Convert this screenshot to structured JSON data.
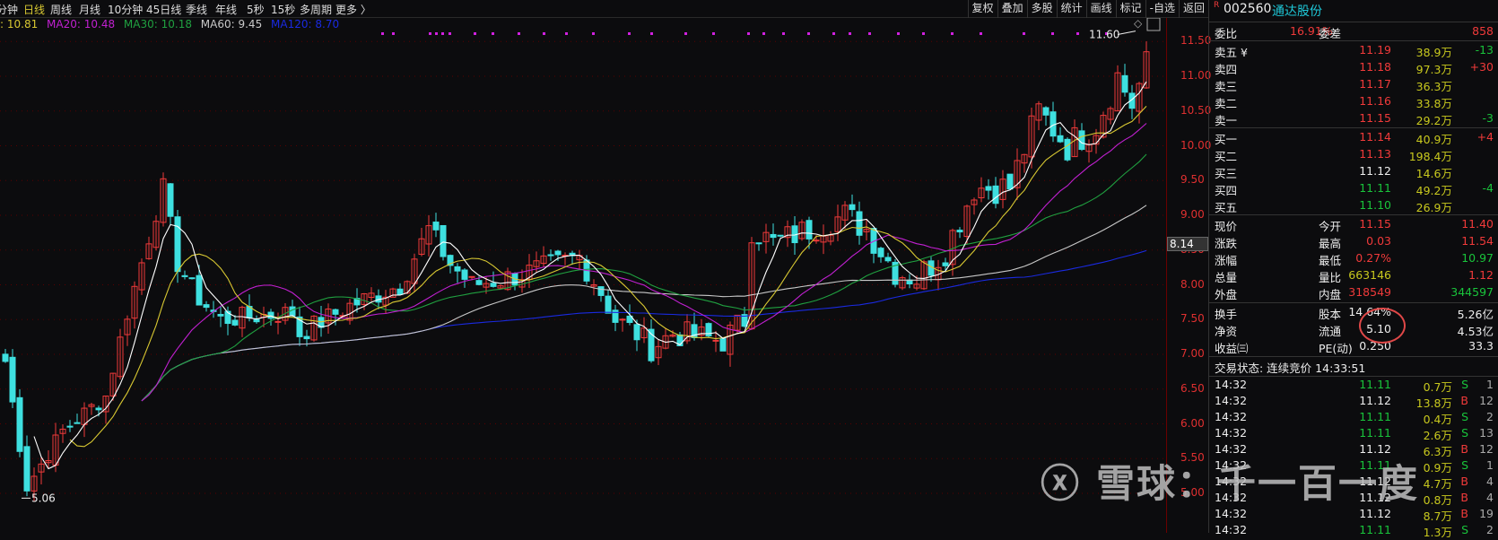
{
  "topbar": {
    "periods": [
      "分钟",
      "日线",
      "周线",
      "月线",
      "10分钟",
      "45日线",
      "季线",
      "年线",
      "5秒",
      "15秒",
      "多周期",
      "更多 〉"
    ],
    "active": "日线",
    "tools": [
      "复权",
      "叠加",
      "多股",
      "统计",
      "画线",
      "标记",
      "-自选",
      "返回"
    ]
  },
  "legend": {
    "ma10": ": 10.81",
    "ma20": "MA20: 10.48",
    "ma30": "MA30: 10.18",
    "ma60": "MA60: 9.45",
    "ma120": "MA120: 8.70"
  },
  "colors": {
    "up": "#f03a3a",
    "down": "#3ee0e0",
    "ma5": "#ffffff",
    "ma10": "#d8c832",
    "ma20": "#c020d0",
    "ma30": "#20a040",
    "ma60": "#c8c8c8",
    "ma120": "#1a2ae0"
  },
  "chart_data": {
    "type": "candlestick",
    "ylim": [
      5.0,
      11.75
    ],
    "yticks": [
      "11.50",
      "11.00",
      "10.50",
      "10.00",
      "9.50",
      "9.00",
      "8.50",
      "8.00",
      "7.50",
      "7.00",
      "6.50",
      "6.00",
      "5.50",
      "5.00"
    ],
    "price_path": [
      [
        0,
        6.9
      ],
      [
        3,
        5.1
      ],
      [
        8,
        5.9
      ],
      [
        14,
        6.4
      ],
      [
        17,
        7.6
      ],
      [
        22,
        9.4
      ],
      [
        24,
        8.3
      ],
      [
        27,
        7.8
      ],
      [
        30,
        7.5
      ],
      [
        40,
        7.6
      ],
      [
        41,
        7.3
      ],
      [
        48,
        7.7
      ],
      [
        55,
        8.0
      ],
      [
        59,
        8.8
      ],
      [
        62,
        8.3
      ],
      [
        65,
        8.0
      ],
      [
        70,
        8.1
      ],
      [
        77,
        8.3
      ],
      [
        80,
        8.4
      ],
      [
        83,
        7.9
      ],
      [
        85,
        7.5
      ],
      [
        88,
        7.3
      ],
      [
        90,
        7.1
      ],
      [
        93,
        7.3
      ],
      [
        100,
        7.2
      ],
      [
        103,
        7.5
      ],
      [
        104,
        8.8
      ],
      [
        107,
        8.6
      ],
      [
        112,
        8.8
      ],
      [
        117,
        9.0
      ],
      [
        120,
        8.8
      ],
      [
        124,
        8.2
      ],
      [
        127,
        8.1
      ],
      [
        131,
        8.5
      ],
      [
        135,
        9.4
      ],
      [
        140,
        9.4
      ],
      [
        144,
        10.5
      ],
      [
        148,
        10.0
      ],
      [
        152,
        10.3
      ],
      [
        155,
        11.0
      ],
      [
        157,
        10.6
      ],
      [
        159,
        11.15
      ]
    ],
    "annotations": {
      "low": "5.06",
      "high": "11.60"
    },
    "crosshair": "8.14"
  },
  "panel": {
    "code": "002560",
    "name": "通达股份",
    "badge": "R",
    "wb": {
      "l1": "委比",
      "v1": "16.91%",
      "l2": "委差",
      "v2": "858"
    },
    "asks": [
      {
        "l": "卖五 ¥",
        "p": "11.19",
        "v": "38.9万",
        "d": "-13"
      },
      {
        "l": "卖四",
        "p": "11.18",
        "v": "97.3万",
        "d": "+30"
      },
      {
        "l": "卖三",
        "p": "11.17",
        "v": "36.3万",
        "d": ""
      },
      {
        "l": "卖二",
        "p": "11.16",
        "v": "33.8万",
        "d": ""
      },
      {
        "l": "卖一",
        "p": "11.15",
        "v": "29.2万",
        "d": "-3"
      }
    ],
    "bids": [
      {
        "l": "买一",
        "p": "11.14",
        "v": "40.9万",
        "d": "+4"
      },
      {
        "l": "买二",
        "p": "11.13",
        "v": "198.4万",
        "d": ""
      },
      {
        "l": "买三",
        "p": "11.12",
        "v": "14.6万",
        "d": ""
      },
      {
        "l": "买四",
        "p": "11.11",
        "v": "49.2万",
        "d": "-4"
      },
      {
        "l": "买五",
        "p": "11.10",
        "v": "26.9万",
        "d": ""
      }
    ],
    "stats": [
      {
        "l1": "现价",
        "v1": "11.15",
        "l2": "今开",
        "v2": "11.40"
      },
      {
        "l1": "涨跌",
        "v1": "0.03",
        "l2": "最高",
        "v2": "11.54"
      },
      {
        "l1": "涨幅",
        "v1": "0.27%",
        "l2": "最低",
        "v2": "10.97"
      },
      {
        "l1": "总量",
        "v1": "663146",
        "l2": "量比",
        "v2": "1.12"
      },
      {
        "l1": "外盘",
        "v1": "318549",
        "l2": "内盘",
        "v2": "344597"
      }
    ],
    "fund": [
      {
        "l1": "换手",
        "v1": "14.64%",
        "l2": "股本",
        "v2": "5.26亿"
      },
      {
        "l1": "净资",
        "v1": "5.10",
        "l2": "流通",
        "v2": "4.53亿"
      },
      {
        "l1": "收益㈢",
        "v1": "0.250",
        "l2": "PE(动)",
        "v2": "33.3"
      }
    ],
    "status": "交易状态: 连续竞价 14:33:51",
    "trades": [
      [
        "14:32",
        "11.11",
        "0.7万",
        "S",
        "1"
      ],
      [
        "14:32",
        "11.12",
        "13.8万",
        "B",
        "12"
      ],
      [
        "14:32",
        "11.11",
        "0.4万",
        "S",
        "2"
      ],
      [
        "14:32",
        "11.11",
        "2.6万",
        "S",
        "13"
      ],
      [
        "14:32",
        "11.12",
        "6.3万",
        "B",
        "12"
      ],
      [
        "14:32",
        "11.11",
        "0.9万",
        "S",
        "1"
      ],
      [
        "14:32",
        "11.12",
        "4.7万",
        "B",
        "4"
      ],
      [
        "14:32",
        "11.12",
        "0.8万",
        "B",
        "4"
      ],
      [
        "14:32",
        "11.12",
        "8.7万",
        "B",
        "19"
      ],
      [
        "14:32",
        "11.11",
        "1.3万",
        "S",
        "2"
      ]
    ]
  },
  "watermark": "雪球：千一百一度"
}
